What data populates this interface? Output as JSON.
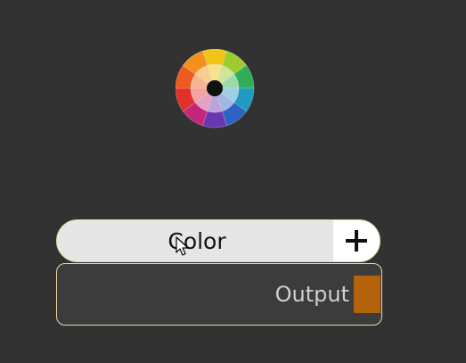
{
  "node": {
    "title": "Color",
    "add_icon": "plus-icon",
    "output_label": "Output",
    "output_port_color": "#b5620c",
    "border_color": "#e8d9a0"
  },
  "icons": {
    "node_icon": "color-wheel-icon",
    "pointer": "mouse-cursor-icon"
  },
  "colors": {
    "background": "#323232",
    "header_background": "#e6e6e6",
    "body_background": "#3c3c3c"
  }
}
